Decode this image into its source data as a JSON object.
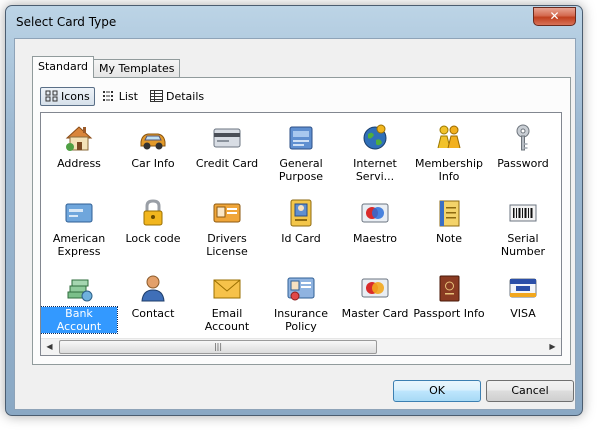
{
  "window": {
    "title": "Select Card Type",
    "close_label": "✕"
  },
  "tabs": [
    {
      "label": "Standard",
      "active": true
    },
    {
      "label": "My Templates",
      "active": false
    }
  ],
  "view_modes": [
    {
      "label": "Icons",
      "icon": "large-icons-icon",
      "active": true
    },
    {
      "label": "List",
      "icon": "list-view-icon",
      "active": false
    },
    {
      "label": "Details",
      "icon": "details-view-icon",
      "active": false
    }
  ],
  "items": [
    {
      "label": "Address",
      "icon": "house-icon"
    },
    {
      "label": "Car Info",
      "icon": "car-icon"
    },
    {
      "label": "Credit Card",
      "icon": "credit-card-icon"
    },
    {
      "label": "General Purpose",
      "icon": "folder-icon"
    },
    {
      "label": "Internet Servi...",
      "icon": "globe-icon"
    },
    {
      "label": "Membership Info",
      "icon": "people-icon"
    },
    {
      "label": "Password",
      "icon": "key-icon"
    },
    {
      "label": "American Express",
      "icon": "amex-card-icon"
    },
    {
      "label": "Lock code",
      "icon": "padlock-icon"
    },
    {
      "label": "Drivers License",
      "icon": "license-card-icon"
    },
    {
      "label": "Id Card",
      "icon": "id-card-icon"
    },
    {
      "label": "Maestro",
      "icon": "maestro-card-icon"
    },
    {
      "label": "Note",
      "icon": "notepad-icon"
    },
    {
      "label": "Serial Number",
      "icon": "barcode-icon"
    },
    {
      "label": "Bank Account",
      "icon": "money-icon",
      "selected": true
    },
    {
      "label": "Contact",
      "icon": "person-icon"
    },
    {
      "label": "Email Account",
      "icon": "envelope-icon"
    },
    {
      "label": "Insurance Policy",
      "icon": "insurance-icon"
    },
    {
      "label": "Master Card",
      "icon": "mastercard-icon"
    },
    {
      "label": "Passport Info",
      "icon": "passport-icon"
    },
    {
      "label": "VISA",
      "icon": "visa-card-icon"
    }
  ],
  "buttons": {
    "ok": "OK",
    "cancel": "Cancel"
  },
  "scrollbar": {
    "left_arrow": "◀",
    "right_arrow": "▶",
    "thumb_grip": "|||"
  },
  "colors": {
    "selection": "#3399ff",
    "default_button": "#bee6fd",
    "title_bar": "#9db9d2",
    "close_button": "#c0401f"
  }
}
